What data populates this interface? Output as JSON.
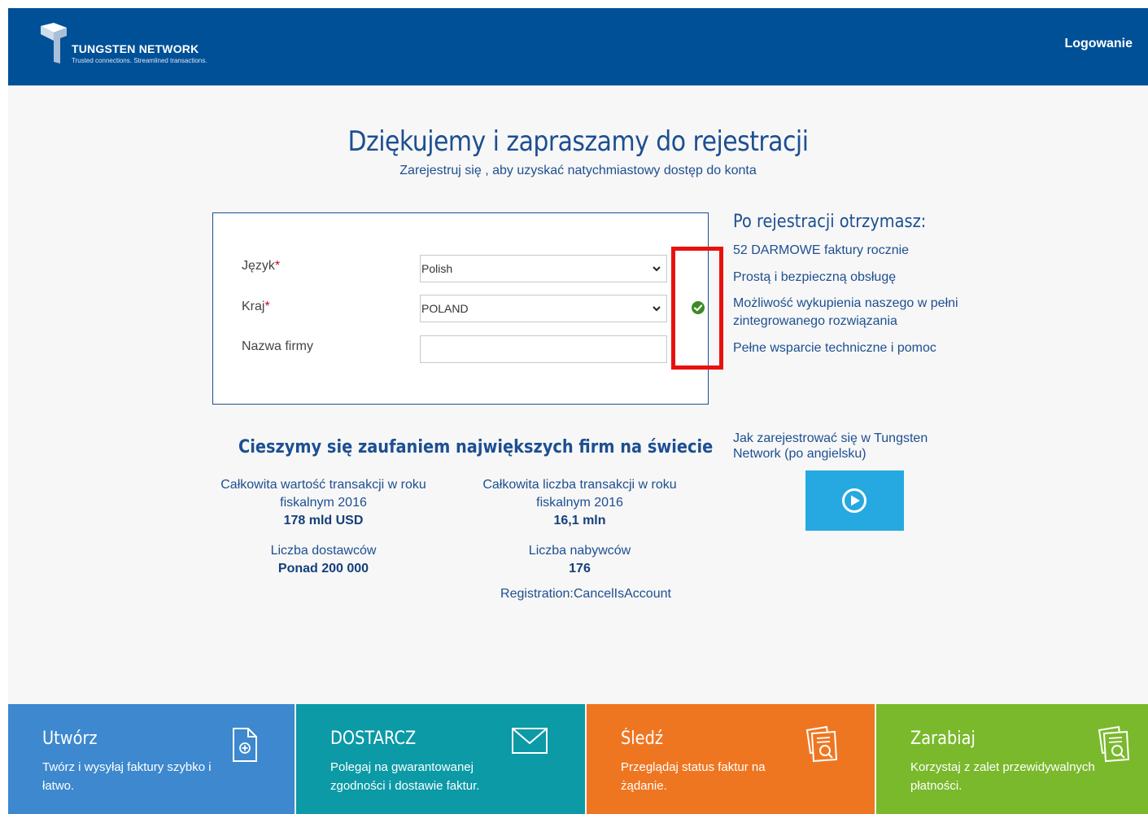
{
  "header": {
    "brand_name": "TUNGSTEN NETWORK",
    "brand_tagline": "Trusted connections. Streamlined transactions.",
    "login_label": "Logowanie"
  },
  "main": {
    "title": "Dziękujemy i zapraszamy do rejestracji",
    "subtitle": "Zarejestruj się , aby uzyskać natychmiastowy dostęp do konta"
  },
  "form": {
    "language_label": "Język",
    "language_value": "Polish",
    "country_label": "Kraj",
    "country_value": "POLAND",
    "company_label": "Nazwa firmy",
    "company_value": "",
    "required_mark": "*"
  },
  "benefits": {
    "title": "Po rejestracji otrzymasz:",
    "items": [
      "52 DARMOWE faktury rocznie",
      "Prostą i bezpieczną obsługę",
      "Możliwość wykupienia naszego w pełni zintegrowanego rozwiązania",
      "Pełne wsparcie techniczne i pomoc"
    ]
  },
  "trust": {
    "title": "Cieszymy się zaufaniem największych firm na świecie",
    "stats": [
      {
        "label": "Całkowita wartość transakcji w roku fiskalnym 2016",
        "value": "178 mld USD"
      },
      {
        "label": "Całkowita liczba transakcji w roku fiskalnym 2016",
        "value": "16,1 mln"
      },
      {
        "label": "Liczba dostawców",
        "value": "Ponad 200 000"
      },
      {
        "label": "Liczba nabywców",
        "value": "176"
      }
    ],
    "registration_text": "Registration:CancelIsAccount"
  },
  "video": {
    "title": "Jak zarejestrować się w Tungsten Network (po angielsku)"
  },
  "tiles": [
    {
      "title": "Utwórz",
      "desc": "Twórz i wysyłaj faktury szybko i łatwo.",
      "color": "#3d88ce",
      "icon": "document-add-icon"
    },
    {
      "title": "DOSTARCZ",
      "desc": "Polegaj na gwarantowanej zgodności i dostawie faktur.",
      "color": "#0b9aa6",
      "icon": "envelope-icon"
    },
    {
      "title": "Śledź",
      "desc": "Przeglądaj status faktur na żądanie.",
      "color": "#ef7621",
      "icon": "invoice-search-icon"
    },
    {
      "title": "Zarabiaj",
      "desc": "Korzystaj z zalet przewidywalnych płatności.",
      "color": "#7ab92c",
      "icon": "invoice-search-icon"
    }
  ],
  "colors": {
    "header_bg": "#005097",
    "primary_text": "#1d4f91",
    "highlight": "#e8110f",
    "check": "#3c8a26",
    "video_bg": "#26a8e0"
  }
}
